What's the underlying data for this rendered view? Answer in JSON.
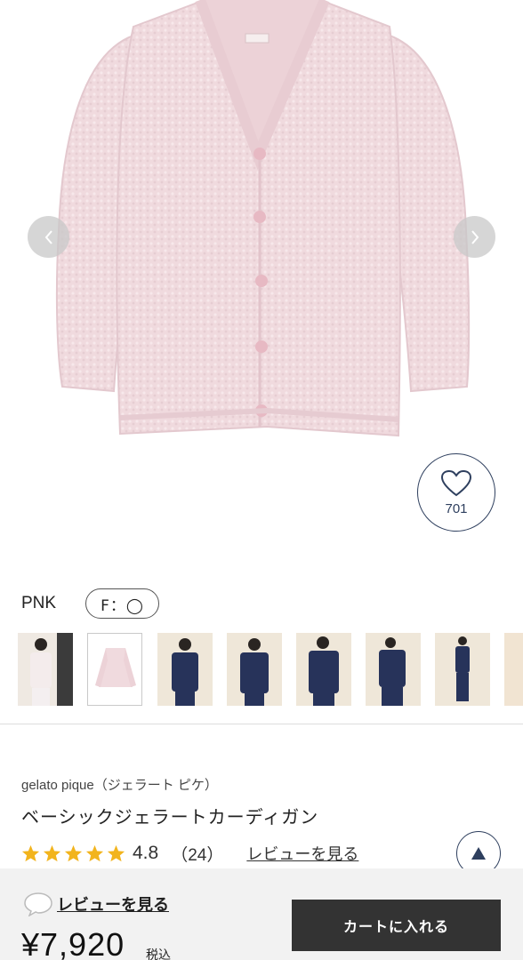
{
  "product": {
    "color_name": "PNK",
    "size_label": "F：◯",
    "favorite_count": "701",
    "brand": "gelato pique（ジェラート ピケ）",
    "title": "ベーシックジェラートカーディガン",
    "rating": "4.8",
    "review_count": "（24）",
    "review_link": "レビューを見る",
    "main_color": "#f0dade"
  },
  "bottom_bar": {
    "review_label": "レビューを見る",
    "price": "¥7,920",
    "tax_label": "税込",
    "cart_button": "カートに入れる"
  },
  "thumbnails": [
    {
      "kind": "model-white"
    },
    {
      "kind": "pink-cardigan"
    },
    {
      "kind": "model-navy"
    },
    {
      "kind": "model-navy"
    },
    {
      "kind": "model-navy"
    },
    {
      "kind": "model-navy"
    },
    {
      "kind": "model-navy-full"
    },
    {
      "kind": "partial"
    }
  ],
  "colors": {
    "accent": "#2e3f5e",
    "star": "#f2b41d",
    "cart_bg": "#333333"
  },
  "icons": {
    "prev": "chevron-left-icon",
    "next": "chevron-right-icon",
    "favorite": "heart-icon",
    "scroll_top": "triangle-up-icon",
    "review": "speech-bubble-icon"
  }
}
